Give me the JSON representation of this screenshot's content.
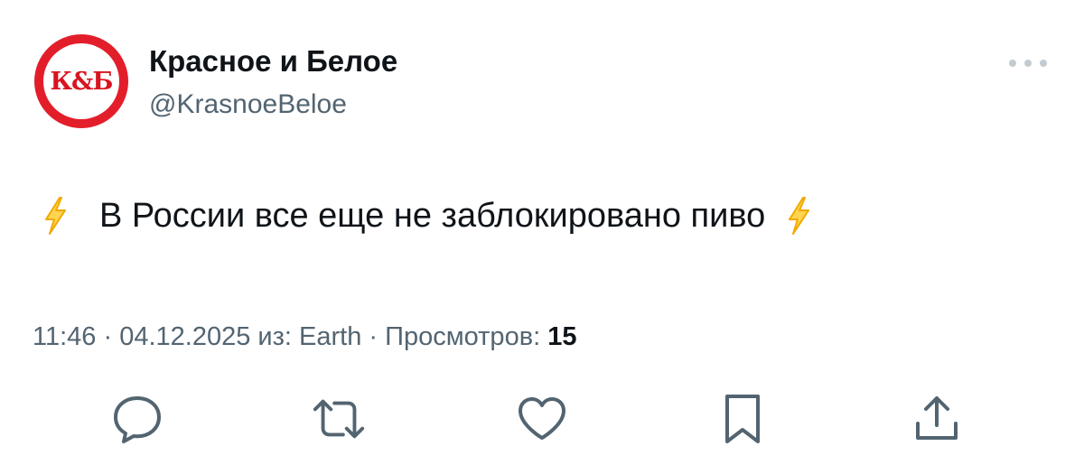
{
  "author": {
    "avatar_text": "К&Б",
    "display_name": "Красное и Белое",
    "handle": "@KrasnoeBeloe"
  },
  "tweet": {
    "text": "В России все еще не заблокировано пиво",
    "emoji_left": "lightning-bolt",
    "emoji_right": "lightning-bolt"
  },
  "meta": {
    "time": "11:46",
    "sep1": " · ",
    "date": "04.12.2025",
    "source_label": " из: Earth",
    "sep2": " · ",
    "views_label": "Просмотров: ",
    "views_count": "15"
  },
  "actions": [
    {
      "name": "reply",
      "icon": "comment-icon"
    },
    {
      "name": "retweet",
      "icon": "retweet-icon"
    },
    {
      "name": "like",
      "icon": "heart-icon"
    },
    {
      "name": "bookmark",
      "icon": "bookmark-icon"
    },
    {
      "name": "share",
      "icon": "share-icon"
    }
  ],
  "colors": {
    "brand_red": "#e31e2b",
    "text": "#0f1419",
    "secondary": "#536471",
    "icon": "#536471",
    "bolt": "#f4b400"
  }
}
